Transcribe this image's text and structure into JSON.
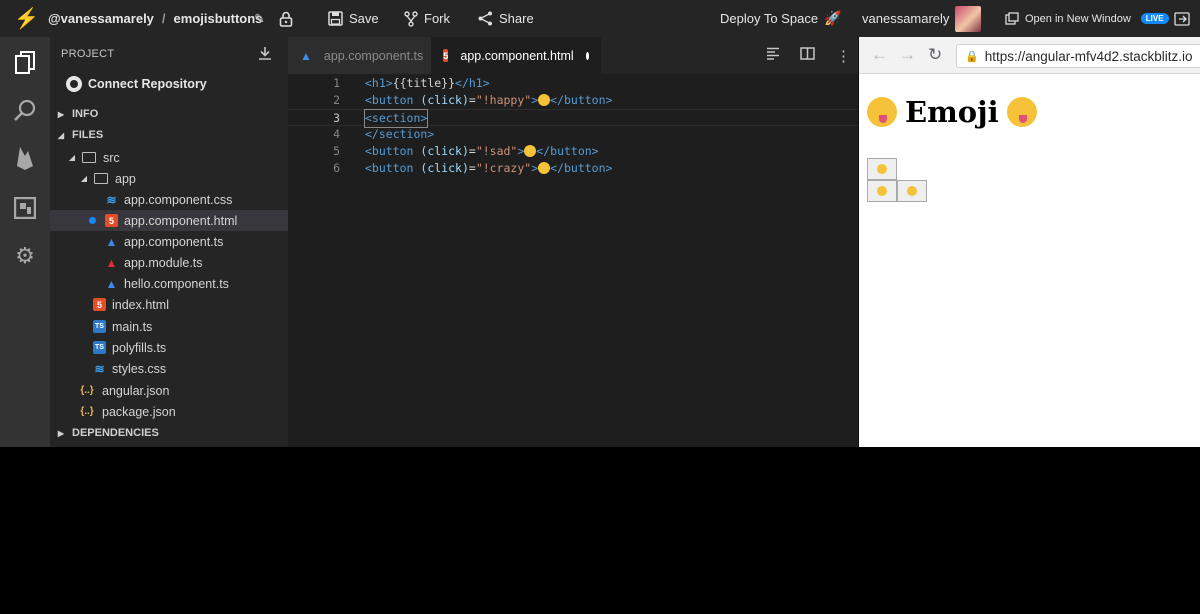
{
  "topbar": {
    "user_handle": "@vanessamarely",
    "separator": "/",
    "project_name": "emojisbuttons",
    "save_label": "Save",
    "fork_label": "Fork",
    "share_label": "Share",
    "deploy_label": "Deploy To Space",
    "username": "vanessamarely",
    "open_window_label": "Open in New Window",
    "live_badge": "LIVE"
  },
  "sidebar": {
    "header": "PROJECT",
    "connect_label": "Connect Repository",
    "sections": {
      "info": "INFO",
      "files": "FILES",
      "dependencies": "DEPENDENCIES"
    },
    "tree": [
      {
        "label": "src",
        "icon": "folder-icon"
      },
      {
        "label": "app",
        "icon": "folder-icon"
      },
      {
        "label": "app.component.css",
        "icon": "css-file-icon"
      },
      {
        "label": "app.component.html",
        "icon": "html-file-icon",
        "selected": true,
        "modified": true
      },
      {
        "label": "app.component.ts",
        "icon": "angular-file-icon"
      },
      {
        "label": "app.module.ts",
        "icon": "angular-module-icon"
      },
      {
        "label": "hello.component.ts",
        "icon": "angular-file-icon"
      },
      {
        "label": "index.html",
        "icon": "html-file-icon"
      },
      {
        "label": "main.ts",
        "icon": "typescript-file-icon"
      },
      {
        "label": "polyfills.ts",
        "icon": "typescript-file-icon"
      },
      {
        "label": "styles.css",
        "icon": "css-file-icon"
      },
      {
        "label": "angular.json",
        "icon": "json-file-icon"
      },
      {
        "label": "package.json",
        "icon": "json-file-icon"
      }
    ]
  },
  "editor": {
    "tabs": [
      {
        "label": "app.component.ts",
        "active": false
      },
      {
        "label": "app.component.html",
        "active": true,
        "dirty": true
      }
    ],
    "current_line": 3,
    "lines": [
      {
        "num": "1",
        "tag_open": "<h1>",
        "content": "{{title}}",
        "tag_close": "</h1>"
      },
      {
        "num": "2",
        "tag_open": "<button",
        "attr": "(click)",
        "eq": "=",
        "value": "\"!happy\"",
        "gt": ">",
        "tag_close": "</button>"
      },
      {
        "num": "3",
        "tag_open": "<section>"
      },
      {
        "num": "4",
        "tag_open": "</section>"
      },
      {
        "num": "5",
        "tag_open": "<button",
        "attr": "(click)",
        "eq": "=",
        "value": "\"!sad\"",
        "gt": ">",
        "tag_close": "</button>"
      },
      {
        "num": "6",
        "tag_open": "<button",
        "attr": "(click)",
        "eq": "=",
        "value": "\"!crazy\"",
        "gt": ">",
        "tag_close": "</button>"
      }
    ]
  },
  "preview": {
    "url": "https://angular-mfv4d2.stackblitz.io",
    "heading": "Emoji"
  },
  "colors": {
    "accent": "#1389fd",
    "editor_bg": "#1e1e1e",
    "sidebar_bg": "#252526",
    "activity_bg": "#333333"
  }
}
